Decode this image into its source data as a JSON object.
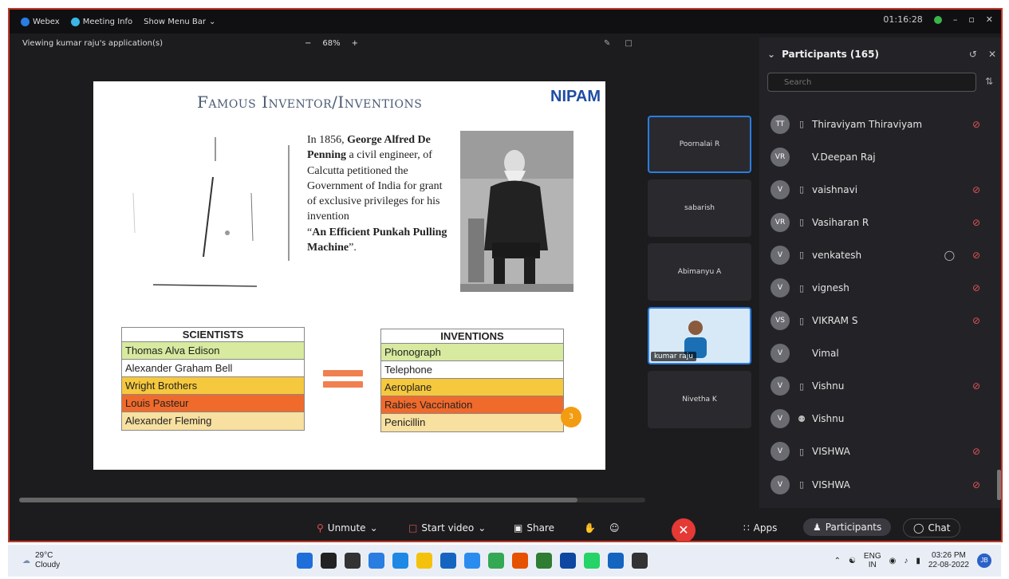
{
  "topbar": {
    "app_name": "Webex",
    "meeting_info": "Meeting Info",
    "show_menu_bar": "Show Menu Bar",
    "timer": "01:16:28",
    "minimize": "–",
    "restore": "▫",
    "close": "✕"
  },
  "viewing": {
    "text": "Viewing kumar raju's application(s)",
    "zoom_out": "−",
    "zoom_level": "68%",
    "zoom_in": "+"
  },
  "slide": {
    "title": "Famous Inventor/Inventions",
    "logo": "NIPAM",
    "para_1": "In 1856, ",
    "para_bold_1": "George Alfred De Penning",
    "para_2": " a civil engineer, of Calcutta petitioned the Government of India for grant of exclusive privileges for his invention",
    "para_quote": "“",
    "para_bold_2": "An Efficient Punkah Pulling Machine",
    "para_end": "”.",
    "scientists_header": "SCIENTISTS",
    "inventions_header": "INVENTIONS",
    "scientists": [
      "Thomas Alva Edison",
      "Alexander Graham Bell",
      "Wright Brothers",
      "Louis Pasteur",
      "Alexander Fleming"
    ],
    "inventions": [
      "Phonograph",
      "Telephone",
      "Aeroplane",
      "Rabies Vaccination",
      "Penicillin"
    ],
    "row_colors": [
      "#d7ea9f",
      "#ffffff",
      "#f6c83d",
      "#f06a2c",
      "#f7e0a0"
    ],
    "badge": "3"
  },
  "video_tiles": [
    {
      "name": "Poornalai R"
    },
    {
      "name": "sabarish"
    },
    {
      "name": "Abimanyu A"
    },
    {
      "name": "kumar raju"
    },
    {
      "name": "Nivetha K"
    }
  ],
  "participants": {
    "title": "Participants (165)",
    "search_placeholder": "Search",
    "list": [
      {
        "initials": "TT",
        "name": "Thiraviyam Thiraviyam",
        "device": "phone",
        "muted": true,
        "chat": false
      },
      {
        "initials": "VR",
        "name": "V.Deepan Raj",
        "device": "",
        "muted": false,
        "chat": false
      },
      {
        "initials": "V",
        "name": "vaishnavi",
        "device": "phone",
        "muted": true,
        "chat": false
      },
      {
        "initials": "VR",
        "name": "Vasiharan R",
        "device": "phone",
        "muted": true,
        "chat": false
      },
      {
        "initials": "V",
        "name": "venkatesh",
        "device": "phone",
        "muted": true,
        "chat": true
      },
      {
        "initials": "V",
        "name": "vignesh",
        "device": "phone",
        "muted": true,
        "chat": false
      },
      {
        "initials": "VS",
        "name": "VIKRAM S",
        "device": "phone",
        "muted": true,
        "chat": false
      },
      {
        "initials": "V",
        "name": "Vimal",
        "device": "",
        "muted": false,
        "chat": false
      },
      {
        "initials": "V",
        "name": "Vishnu",
        "device": "phone",
        "muted": true,
        "chat": false
      },
      {
        "initials": "V",
        "name": "Vishnu",
        "device": "location",
        "muted": false,
        "chat": false
      },
      {
        "initials": "V",
        "name": "VISHWA",
        "device": "phone",
        "muted": true,
        "chat": false
      },
      {
        "initials": "V",
        "name": "VISHWA",
        "device": "phone",
        "muted": true,
        "chat": false
      }
    ]
  },
  "controls": {
    "unmute": "Unmute",
    "start_video": "Start video",
    "share": "Share",
    "leave": "✕",
    "apps": "Apps",
    "participants": "Participants",
    "chat": "Chat"
  },
  "taskbar": {
    "temperature": "29°C",
    "weather": "Cloudy",
    "lang_1": "ENG",
    "lang_2": "IN",
    "time": "03:26 PM",
    "date": "22-08-2022",
    "user": "JB",
    "app_colors": [
      "#1e6fd9",
      "#222222",
      "#333333",
      "#2a7de1",
      "#1e88e5",
      "#f4c20d",
      "#1565c0",
      "#2b8cf0",
      "#34a853",
      "#e65100",
      "#2e7d32",
      "#0d47a1",
      "#25d366",
      "#1565c0",
      "#333333"
    ]
  }
}
